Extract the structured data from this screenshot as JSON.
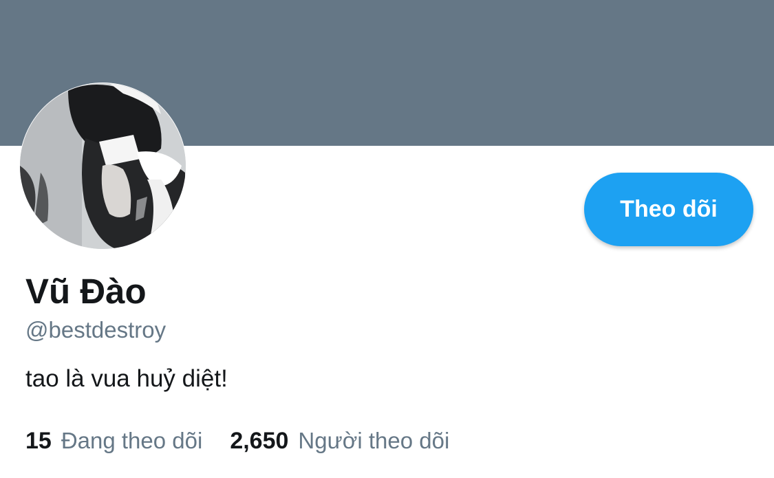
{
  "profile": {
    "banner_color": "#657786",
    "avatar_alt": "profile photo",
    "display_name": "Vũ Đào",
    "handle": "@bestdestroy",
    "bio": "tao là vua huỷ diệt!",
    "follow_button_label": "Theo dõi",
    "accent_color": "#1da1f2"
  },
  "stats": {
    "following_count": "15",
    "following_label": "Đang theo dõi",
    "followers_count": "2,650",
    "followers_label": "Người theo dõi"
  }
}
